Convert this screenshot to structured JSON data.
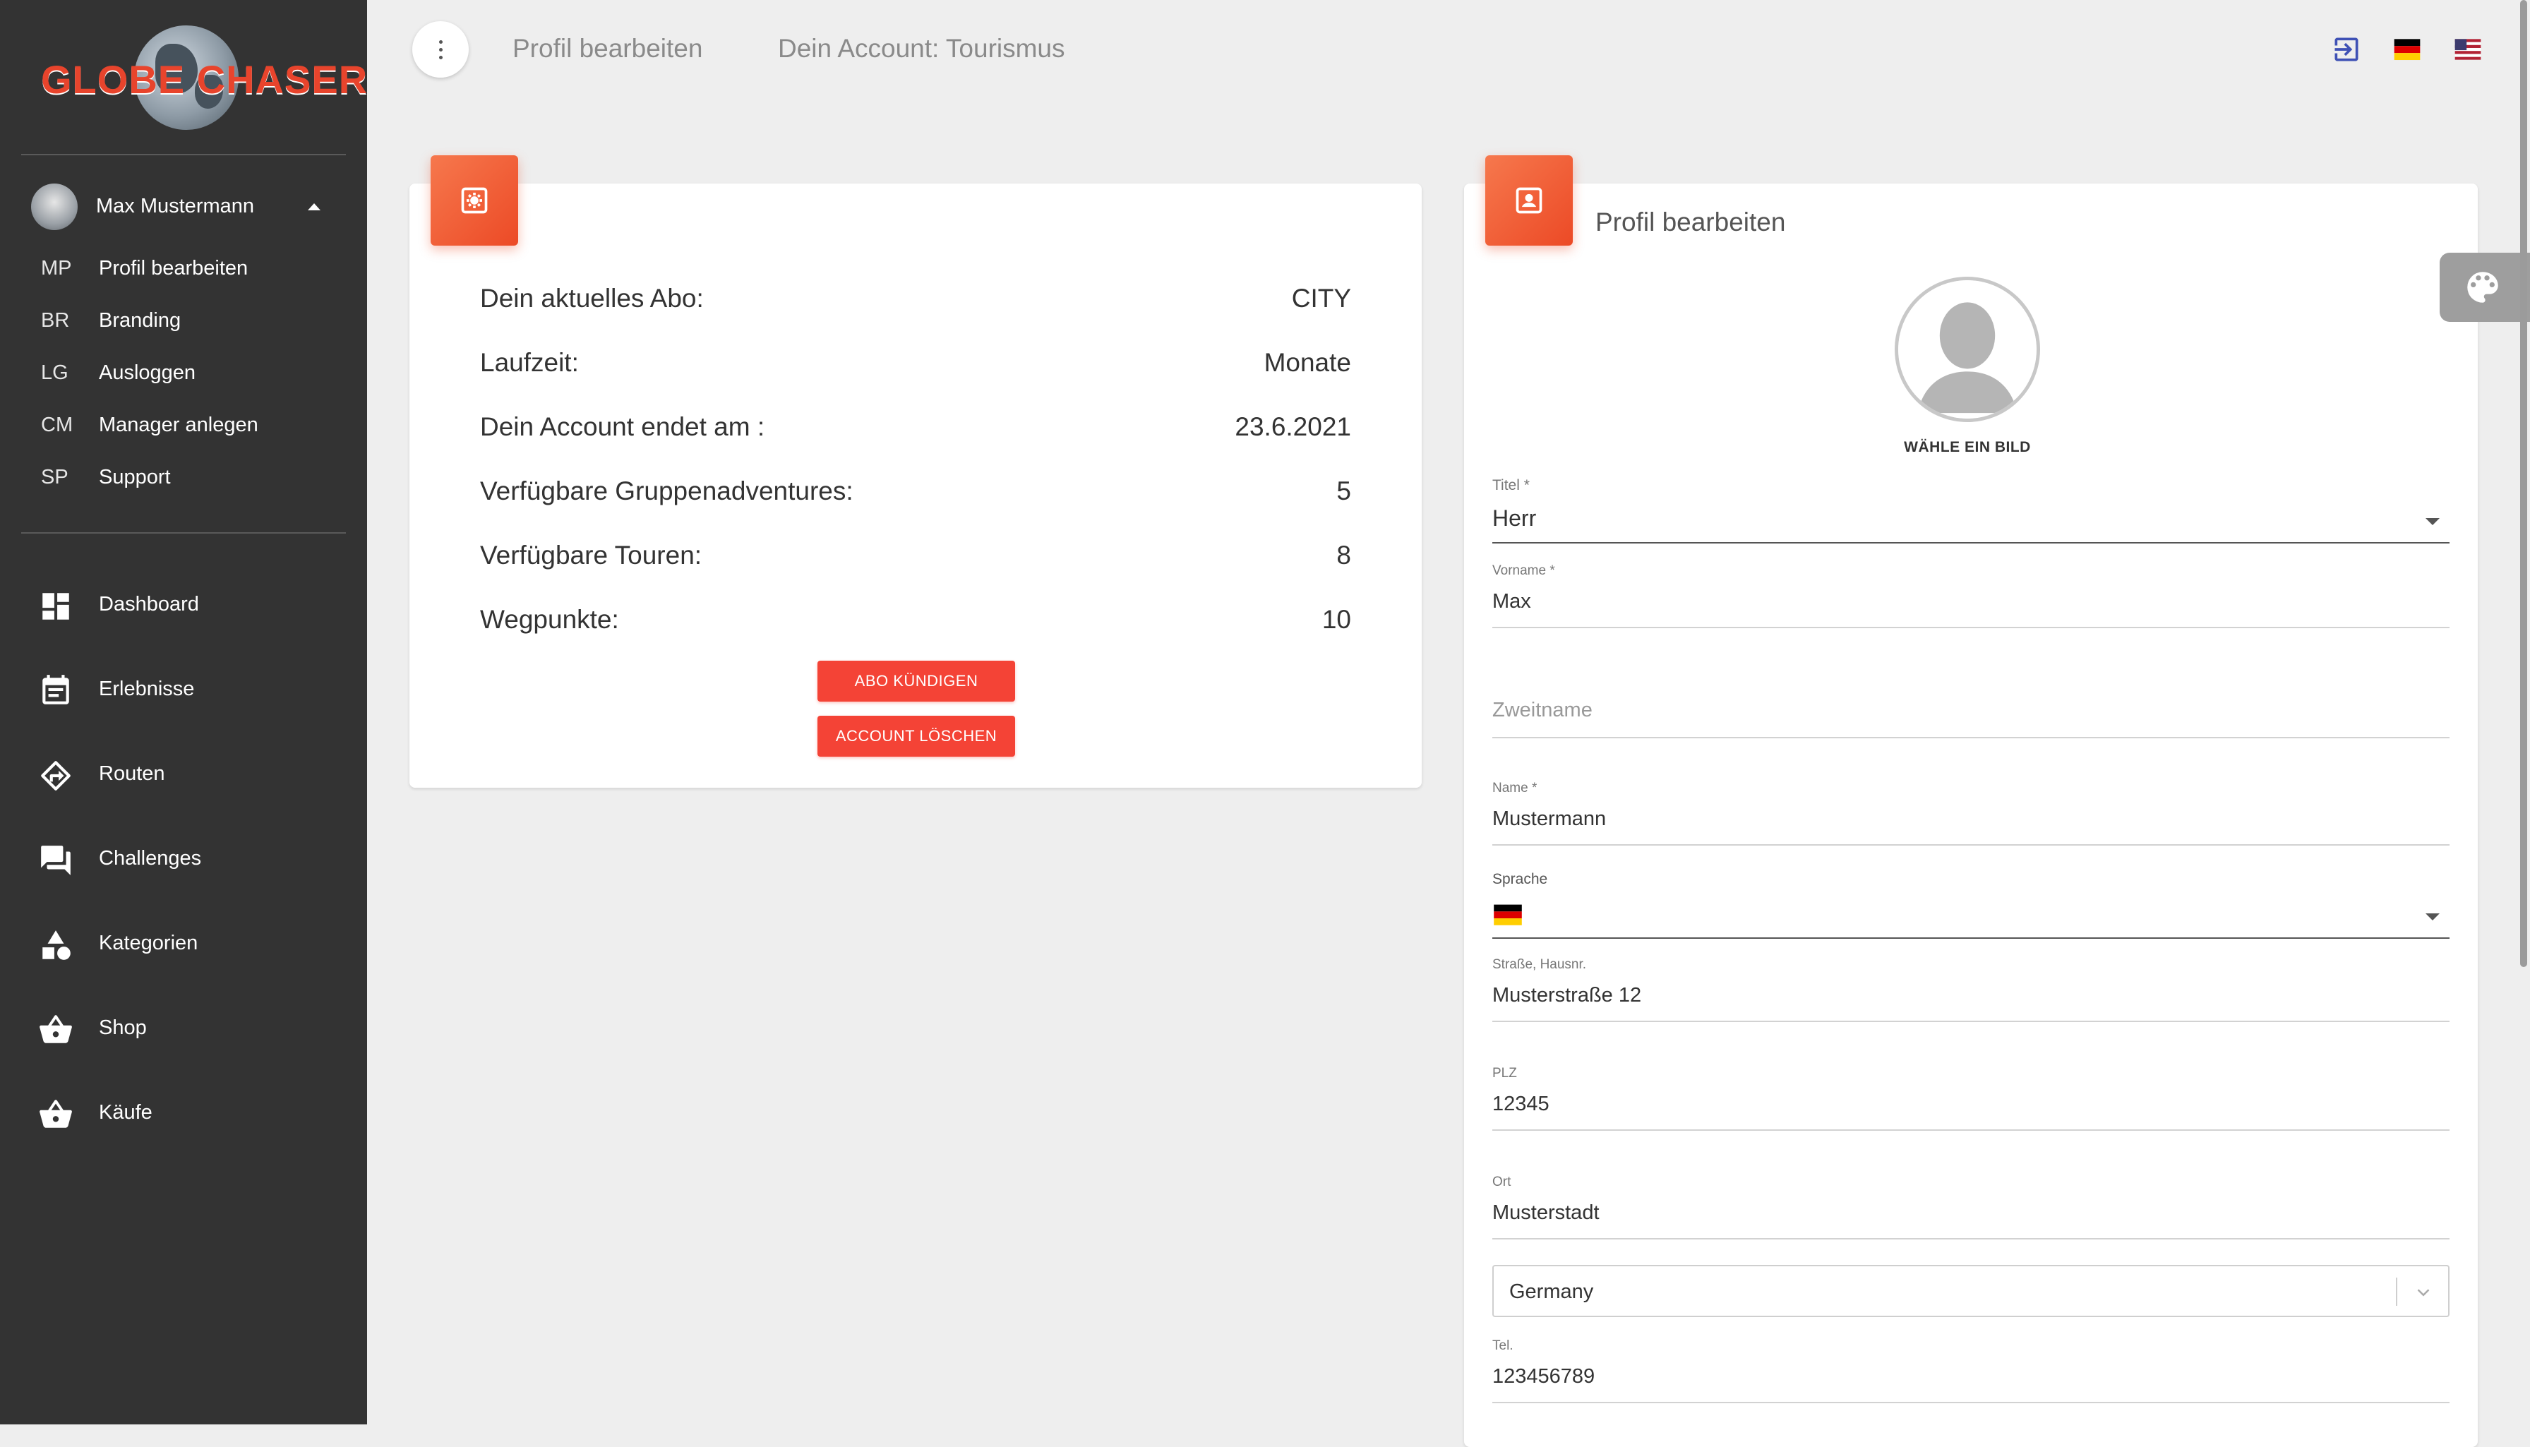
{
  "app": {
    "logo_text": "GLOBE CHASER"
  },
  "sidebar": {
    "user_name": "Max Mustermann",
    "sub_items": [
      {
        "abbr": "MP",
        "label": "Profil bearbeiten"
      },
      {
        "abbr": "BR",
        "label": "Branding"
      },
      {
        "abbr": "LG",
        "label": "Ausloggen"
      },
      {
        "abbr": "CM",
        "label": "Manager anlegen"
      },
      {
        "abbr": "SP",
        "label": "Support"
      }
    ],
    "nav_items": [
      {
        "label": "Dashboard",
        "icon": "dashboard-icon"
      },
      {
        "label": "Erlebnisse",
        "icon": "calendar-icon"
      },
      {
        "label": "Routen",
        "icon": "directions-icon"
      },
      {
        "label": "Challenges",
        "icon": "forum-icon"
      },
      {
        "label": "Kategorien",
        "icon": "category-icon"
      },
      {
        "label": "Shop",
        "icon": "basket-icon"
      },
      {
        "label": "Käufe",
        "icon": "basket-icon"
      }
    ]
  },
  "header": {
    "breadcrumb_1": "Profil bearbeiten",
    "breadcrumb_2": "Dein Account: Tourismus",
    "icons": [
      "logout-icon",
      "flag-de-icon",
      "flag-us-icon"
    ]
  },
  "subscription": {
    "rows": [
      {
        "label": "Dein aktuelles Abo:",
        "value": "CITY"
      },
      {
        "label": "Laufzeit:",
        "value": "Monate"
      },
      {
        "label": "Dein Account endet am :",
        "value": "23.6.2021"
      },
      {
        "label": "Verfügbare Gruppenadventures:",
        "value": "5"
      },
      {
        "label": "Verfügbare Touren:",
        "value": "8"
      },
      {
        "label": "Wegpunkte:",
        "value": "10"
      }
    ],
    "cancel_button": "ABO KÜNDIGEN",
    "delete_button": "ACCOUNT LÖSCHEN"
  },
  "profile": {
    "title": "Profil bearbeiten",
    "photo_caption": "WÄHLE EIN BILD",
    "titel_label": "Titel *",
    "titel_value": "Herr",
    "vorname_label": "Vorname *",
    "vorname_value": "Max",
    "zweitname_placeholder": "Zweitname",
    "name_label": "Name *",
    "name_value": "Mustermann",
    "sprache_label": "Sprache",
    "strasse_label": "Straße, Hausnr.",
    "strasse_value": "Musterstraße 12",
    "plz_label": "PLZ",
    "plz_value": "12345",
    "ort_label": "Ort",
    "ort_value": "Musterstadt",
    "country_value": "Germany",
    "tel_label": "Tel.",
    "tel_value": "123456789"
  },
  "colors": {
    "sidebar_bg": "#333333",
    "accent_orange": "#ec4a26",
    "button_red": "#f44336",
    "page_bg": "#eeeeee"
  }
}
